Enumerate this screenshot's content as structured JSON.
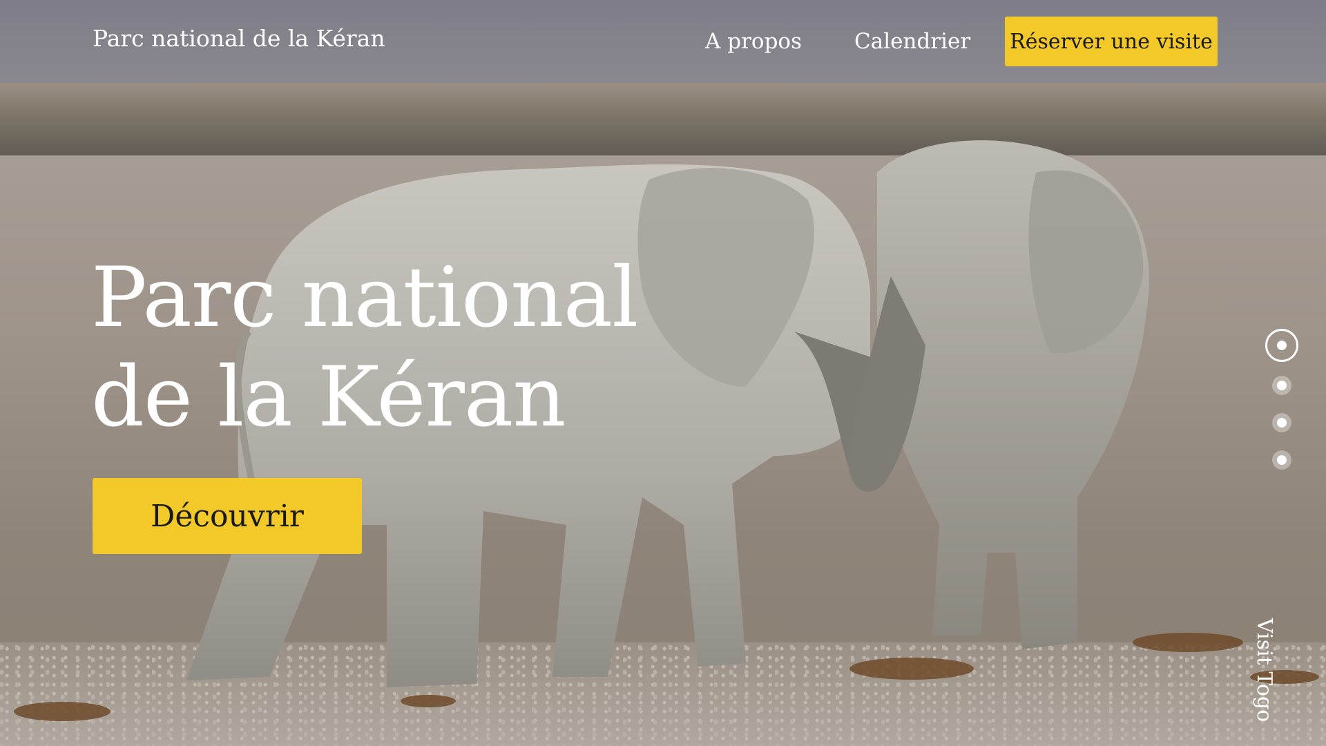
{
  "brand": {
    "name": "Parc national de la Kéran"
  },
  "nav": {
    "links": [
      {
        "label": "A propos"
      },
      {
        "label": "Calendrier"
      }
    ],
    "cta_label": "Réserver une visite"
  },
  "hero": {
    "headline_line1": "Parc national",
    "headline_line2": "de la Kéran",
    "cta_label": "Découvrir",
    "background": "photo of two elephants on dusty savanna",
    "slide_count": 4,
    "active_slide": 1
  },
  "side_label": "Visit Togo",
  "colors": {
    "accent": "#f2c928",
    "text_light": "#ffffff",
    "text_dark": "#1a1a1a"
  },
  "icons": {
    "slide_active": "ring-dot-icon",
    "slide_inactive": "dot-icon"
  }
}
